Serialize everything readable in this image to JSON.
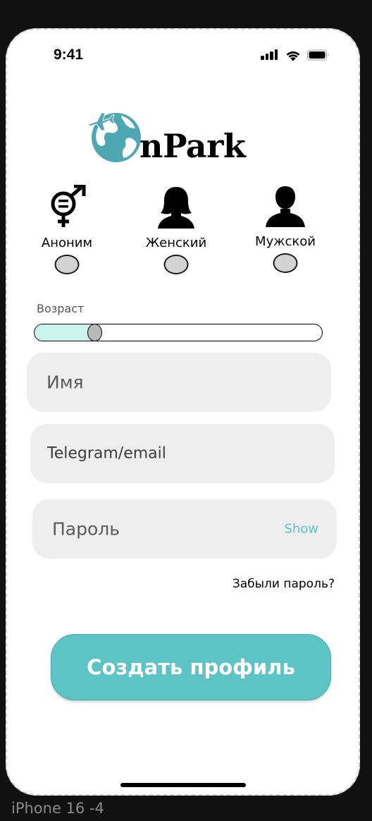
{
  "status_bar": {
    "time": "9:41"
  },
  "logo": {
    "text": "nPark"
  },
  "gender": {
    "options": [
      {
        "label": "Аноним",
        "icon": "gender-neutral-icon",
        "selected": false
      },
      {
        "label": "Женский",
        "icon": "female-avatar-icon",
        "selected": false
      },
      {
        "label": "Мужской",
        "icon": "male-avatar-icon",
        "selected": false
      }
    ]
  },
  "age": {
    "label": "Возраст",
    "value_fraction": 0.21
  },
  "form": {
    "name_placeholder": "Имя",
    "contact_placeholder": "Telegram/email",
    "password_placeholder": "Пароль",
    "show_label": "Show",
    "forgot_label": "Забыли пароль?"
  },
  "create_button": {
    "label": "Создать профиль"
  },
  "device_label": "iPhone 16 -4",
  "colors": {
    "accent": "#5cc4c4",
    "slider_fill": "#cbf4ed",
    "field_bg": "#eeeeee"
  }
}
